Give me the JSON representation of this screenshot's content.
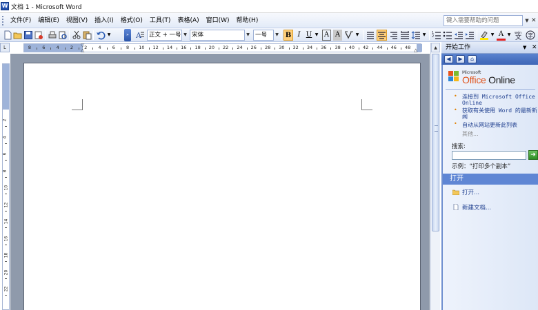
{
  "window": {
    "title": "文档 1 - Microsoft Word",
    "icon": "word-app-icon"
  },
  "menu": {
    "items": [
      "文件(F)",
      "编辑(E)",
      "视图(V)",
      "插入(I)",
      "格式(O)",
      "工具(T)",
      "表格(A)",
      "窗口(W)",
      "帮助(H)"
    ],
    "help_placeholder": "键入需要帮助的问题"
  },
  "toolbar": {
    "style_value": "正文 + 一号",
    "font_value": "宋体",
    "size_value": "一号",
    "bold_label": "B",
    "italic_label": "I",
    "underline_label": "U",
    "font_color_label": "A",
    "highlight_label": "A",
    "aa_label": "A",
    "aa_small_label": "A",
    "active_buttons": [
      "bold",
      "align-center"
    ],
    "accent_color": "#ffcf7a"
  },
  "ruler": {
    "corner_label": "L",
    "h_numbers": [
      "8",
      "6",
      "4",
      "2",
      "2",
      "4",
      "6",
      "8",
      "10",
      "12",
      "14",
      "16",
      "18",
      "20",
      "22",
      "24",
      "26",
      "28",
      "30",
      "32",
      "34",
      "36",
      "38",
      "40",
      "42",
      "44",
      "46",
      "48"
    ],
    "v_numbers": [
      "2",
      "4",
      "6",
      "8",
      "10",
      "12",
      "14",
      "16",
      "18",
      "20",
      "22"
    ]
  },
  "taskpane": {
    "title": "开始工作",
    "logo_small": "Microsoft",
    "logo_main": "Office",
    "logo_main2": "Online",
    "links": [
      {
        "text": "连接到 Microsoft Office",
        "text2": "Online"
      },
      {
        "text": "获取有关使用 Word 的最新新",
        "text2": "闻"
      },
      {
        "text": "自动从网站更新此列表",
        "text2": ""
      }
    ],
    "more": "其他...",
    "search_label": "搜索:",
    "example": "示例：“打印多个副本”",
    "open_section": "打开",
    "actions": [
      "打开...",
      "新建文档..."
    ]
  }
}
